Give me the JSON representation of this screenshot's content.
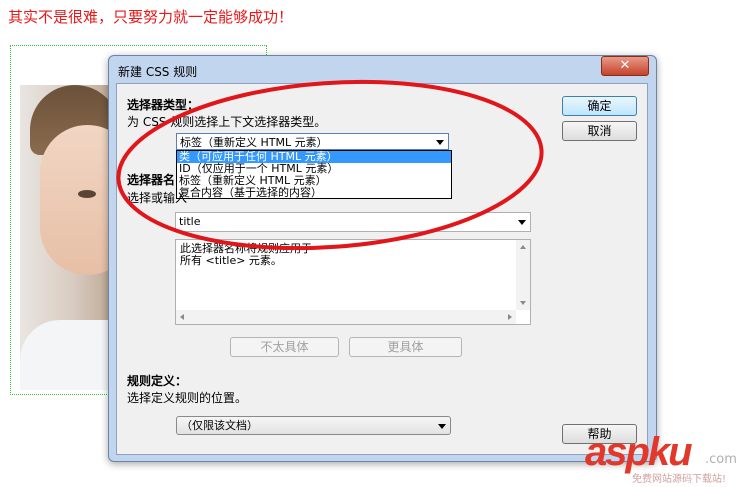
{
  "caption": "其实不是很难，只要努力就一定能够成功！",
  "dialog": {
    "title": "新建 CSS 规则",
    "close_glyph": "✕",
    "selector_type": {
      "heading": "选择器类型：",
      "description": "为 CSS 规则选择上下文选择器类型。",
      "selected": "标签（重新定义 HTML 元素）",
      "options": [
        "类（可应用于任何 HTML 元素）",
        "ID（仅应用于一个 HTML 元素）",
        "标签（重新定义 HTML 元素）",
        "复合内容（基于选择的内容）"
      ],
      "highlighted_index": 0
    },
    "selector_name": {
      "heading": "选择器名",
      "description": "选择或输入",
      "value": "title",
      "preview_lines": [
        "此选择器名称将规则应用于",
        "所有 <title> 元素。"
      ]
    },
    "less_specific_label": "不太具体",
    "more_specific_label": "更具体",
    "rule_definition": {
      "heading": "规则定义：",
      "description": "选择定义规则的位置。",
      "location": "（仅限该文档）"
    },
    "ok_label": "确定",
    "cancel_label": "取消",
    "help_label": "帮助"
  },
  "watermark": {
    "brand": "aspku",
    "sub": "免费网站源码下载站!",
    "suffix": ".com"
  },
  "colors": {
    "caption": "#e8191b",
    "annotation_ellipse": "#e0161b",
    "dialog_frame": "#c2d5ee",
    "highlight": "#3399ff",
    "brand": "#e2382c"
  }
}
